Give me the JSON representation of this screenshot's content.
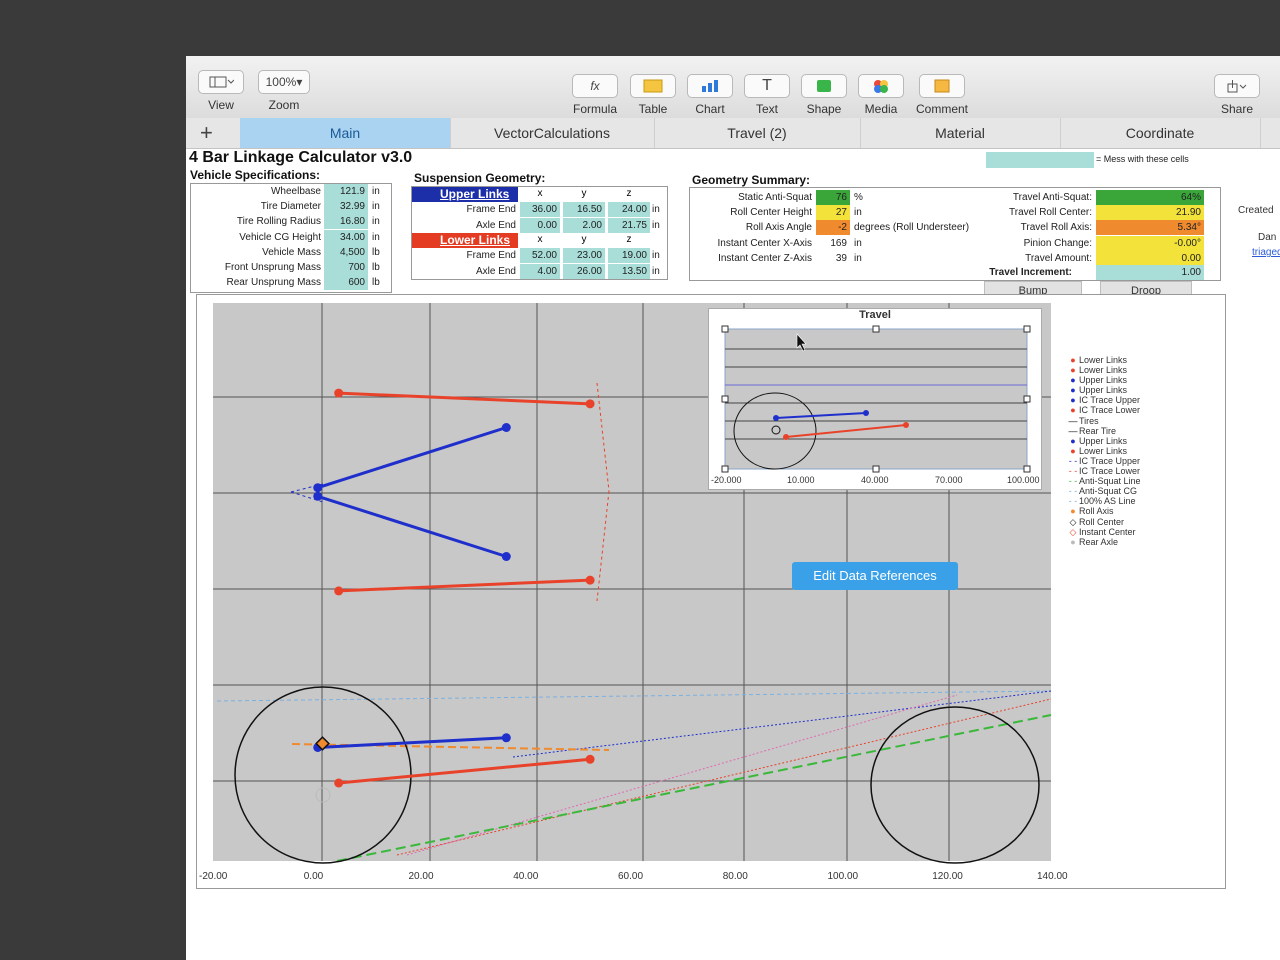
{
  "toolbar": {
    "view_label": "View",
    "zoom_value": "100%",
    "zoom_label": "Zoom",
    "formula_label": "Formula",
    "formula_icon": "fx",
    "table_label": "Table",
    "chart_label": "Chart",
    "text_label": "Text",
    "text_icon": "T",
    "shape_label": "Shape",
    "media_label": "Media",
    "comment_label": "Comment",
    "share_label": "Share"
  },
  "tabs": [
    {
      "label": "Main"
    },
    {
      "label": "VectorCalculations"
    },
    {
      "label": "Travel (2)"
    },
    {
      "label": "Material"
    },
    {
      "label": "Coordinate"
    }
  ],
  "sheet": {
    "title": "4 Bar Linkage Calculator v3.0",
    "mess_note": "= Mess with these cells",
    "vehicle": {
      "heading": "Vehicle Specifications:",
      "rows": [
        {
          "label": "Wheelbase",
          "value": "121.9",
          "unit": "in"
        },
        {
          "label": "Tire Diameter",
          "value": "32.99",
          "unit": "in"
        },
        {
          "label": "Tire Rolling Radius",
          "value": "16.80",
          "unit": "in"
        },
        {
          "label": "Vehicle CG Height",
          "value": "34.00",
          "unit": "in"
        },
        {
          "label": "Vehicle Mass",
          "value": "4,500",
          "unit": "lb"
        },
        {
          "label": "Front Unsprung Mass",
          "value": "700",
          "unit": "lb"
        },
        {
          "label": "Rear Unsprung Mass",
          "value": "600",
          "unit": "lb"
        }
      ]
    },
    "suspension": {
      "heading": "Suspension Geometry:",
      "upper_header": "Upper Links",
      "lower_header": "Lower Links",
      "cols": [
        "x",
        "y",
        "z"
      ],
      "upper": [
        {
          "label": "Frame End",
          "x": "36.00",
          "y": "16.50",
          "z": "24.00",
          "unit": "in"
        },
        {
          "label": "Axle End",
          "x": "0.00",
          "y": "2.00",
          "z": "21.75",
          "unit": "in"
        }
      ],
      "lower": [
        {
          "label": "Frame End",
          "x": "52.00",
          "y": "23.00",
          "z": "19.00",
          "unit": "in"
        },
        {
          "label": "Axle End",
          "x": "4.00",
          "y": "26.00",
          "z": "13.50",
          "unit": "in"
        }
      ]
    },
    "summary": {
      "heading": "Geometry Summary:",
      "left": [
        {
          "label": "Static Anti-Squat",
          "value": "76",
          "unit": "%",
          "color": "#3aa63a"
        },
        {
          "label": "Roll Center Height",
          "value": "27",
          "unit": "in",
          "color": "#f2e23a"
        },
        {
          "label": "Roll Axis Angle",
          "value": "-2",
          "unit": "degrees (Roll Understeer)",
          "color": "#f08a2e"
        },
        {
          "label": "Instant Center X-Axis",
          "value": "169",
          "unit": "in",
          "color": ""
        },
        {
          "label": "Instant Center Z-Axis",
          "value": "39",
          "unit": "in",
          "color": ""
        }
      ],
      "right": [
        {
          "label": "Travel Anti-Squat:",
          "value": "64%",
          "color": "#3aa63a"
        },
        {
          "label": "Travel Roll Center:",
          "value": "21.90",
          "color": "#f2e23a"
        },
        {
          "label": "Travel Roll Axis:",
          "value": "5.34°",
          "color": "#f08a2e"
        },
        {
          "label": "Pinion Change:",
          "value": "-0.00°",
          "color": "#f2e23a"
        },
        {
          "label": "Travel Amount:",
          "value": "0.00",
          "color": "#f2e23a"
        }
      ],
      "increment_label": "Travel Increment:",
      "increment_value": "1.00",
      "bump_label": "Bump",
      "droop_label": "Droop"
    },
    "side_notes": {
      "created": "Created",
      "author": "Dan",
      "email": "triaged@"
    }
  },
  "inset": {
    "title": "Travel",
    "x_ticks": [
      "-20.000",
      "10.000",
      "40.000",
      "70.000",
      "100.000"
    ]
  },
  "edit_button_label": "Edit Data References",
  "legend": [
    {
      "name": "Lower Links",
      "color": "#e8432a",
      "marker": "dot"
    },
    {
      "name": "Lower Links",
      "color": "#e8432a",
      "marker": "dot"
    },
    {
      "name": "Upper Links",
      "color": "#1f2fcc",
      "marker": "dot"
    },
    {
      "name": "Upper Links",
      "color": "#1f2fcc",
      "marker": "dot"
    },
    {
      "name": "IC Trace Upper",
      "color": "#1f2fcc",
      "marker": "dot"
    },
    {
      "name": "IC Trace Lower",
      "color": "#e8432a",
      "marker": "dot"
    },
    {
      "name": "Tires",
      "color": "#111111",
      "marker": "line"
    },
    {
      "name": "Rear Tire",
      "color": "#111111",
      "marker": "line"
    },
    {
      "name": "Upper Links",
      "color": "#1f2fcc",
      "marker": "dot"
    },
    {
      "name": "Lower Links",
      "color": "#e8432a",
      "marker": "dot"
    },
    {
      "name": "IC Trace Upper",
      "color": "#1f2fcc",
      "marker": "dash"
    },
    {
      "name": "IC Trace Lower",
      "color": "#e8432a",
      "marker": "dash"
    },
    {
      "name": "Anti-Squat Line",
      "color": "#3ab83a",
      "marker": "dash"
    },
    {
      "name": "Anti-Squat CG",
      "color": "#7ab0e0",
      "marker": "dash"
    },
    {
      "name": "100% AS Line",
      "color": "#7ab0e0",
      "marker": "dash"
    },
    {
      "name": "Roll Axis",
      "color": "#f08a2e",
      "marker": "dot"
    },
    {
      "name": "Roll Center",
      "color": "#111111",
      "marker": "diamond"
    },
    {
      "name": "Instant Center",
      "color": "#e8432a",
      "marker": "diamond"
    },
    {
      "name": "Rear Axle",
      "color": "#bbbbbb",
      "marker": "dot"
    }
  ],
  "chart_data": {
    "type": "scatter",
    "x_ticks": [
      "-20.00",
      "0.00",
      "20.00",
      "40.00",
      "60.00",
      "80.00",
      "100.00",
      "120.00",
      "140.00"
    ],
    "xlim": [
      -20,
      140
    ],
    "series": [
      {
        "name": "Upper Links",
        "color": "#1f2fcc",
        "kind": "top",
        "segments": [
          [
            [
              0,
              1
            ],
            [
              36,
              15
            ]
          ],
          [
            [
              0,
              -1
            ],
            [
              36,
              -15
            ]
          ]
        ]
      },
      {
        "name": "Lower Links",
        "color": "#e8432a",
        "kind": "top",
        "segments": [
          [
            [
              4,
              23
            ],
            [
              52,
              20.5
            ]
          ],
          [
            [
              4,
              -23
            ],
            [
              52,
              -20.5
            ]
          ]
        ]
      },
      {
        "name": "Upper Links",
        "color": "#1f2fcc",
        "kind": "side",
        "segments": [
          [
            [
              0,
              21.75
            ],
            [
              36,
              24
            ]
          ]
        ]
      },
      {
        "name": "Lower Links",
        "color": "#e8432a",
        "kind": "side",
        "segments": [
          [
            [
              4,
              13.5
            ],
            [
              52,
              19
            ]
          ]
        ]
      }
    ]
  }
}
